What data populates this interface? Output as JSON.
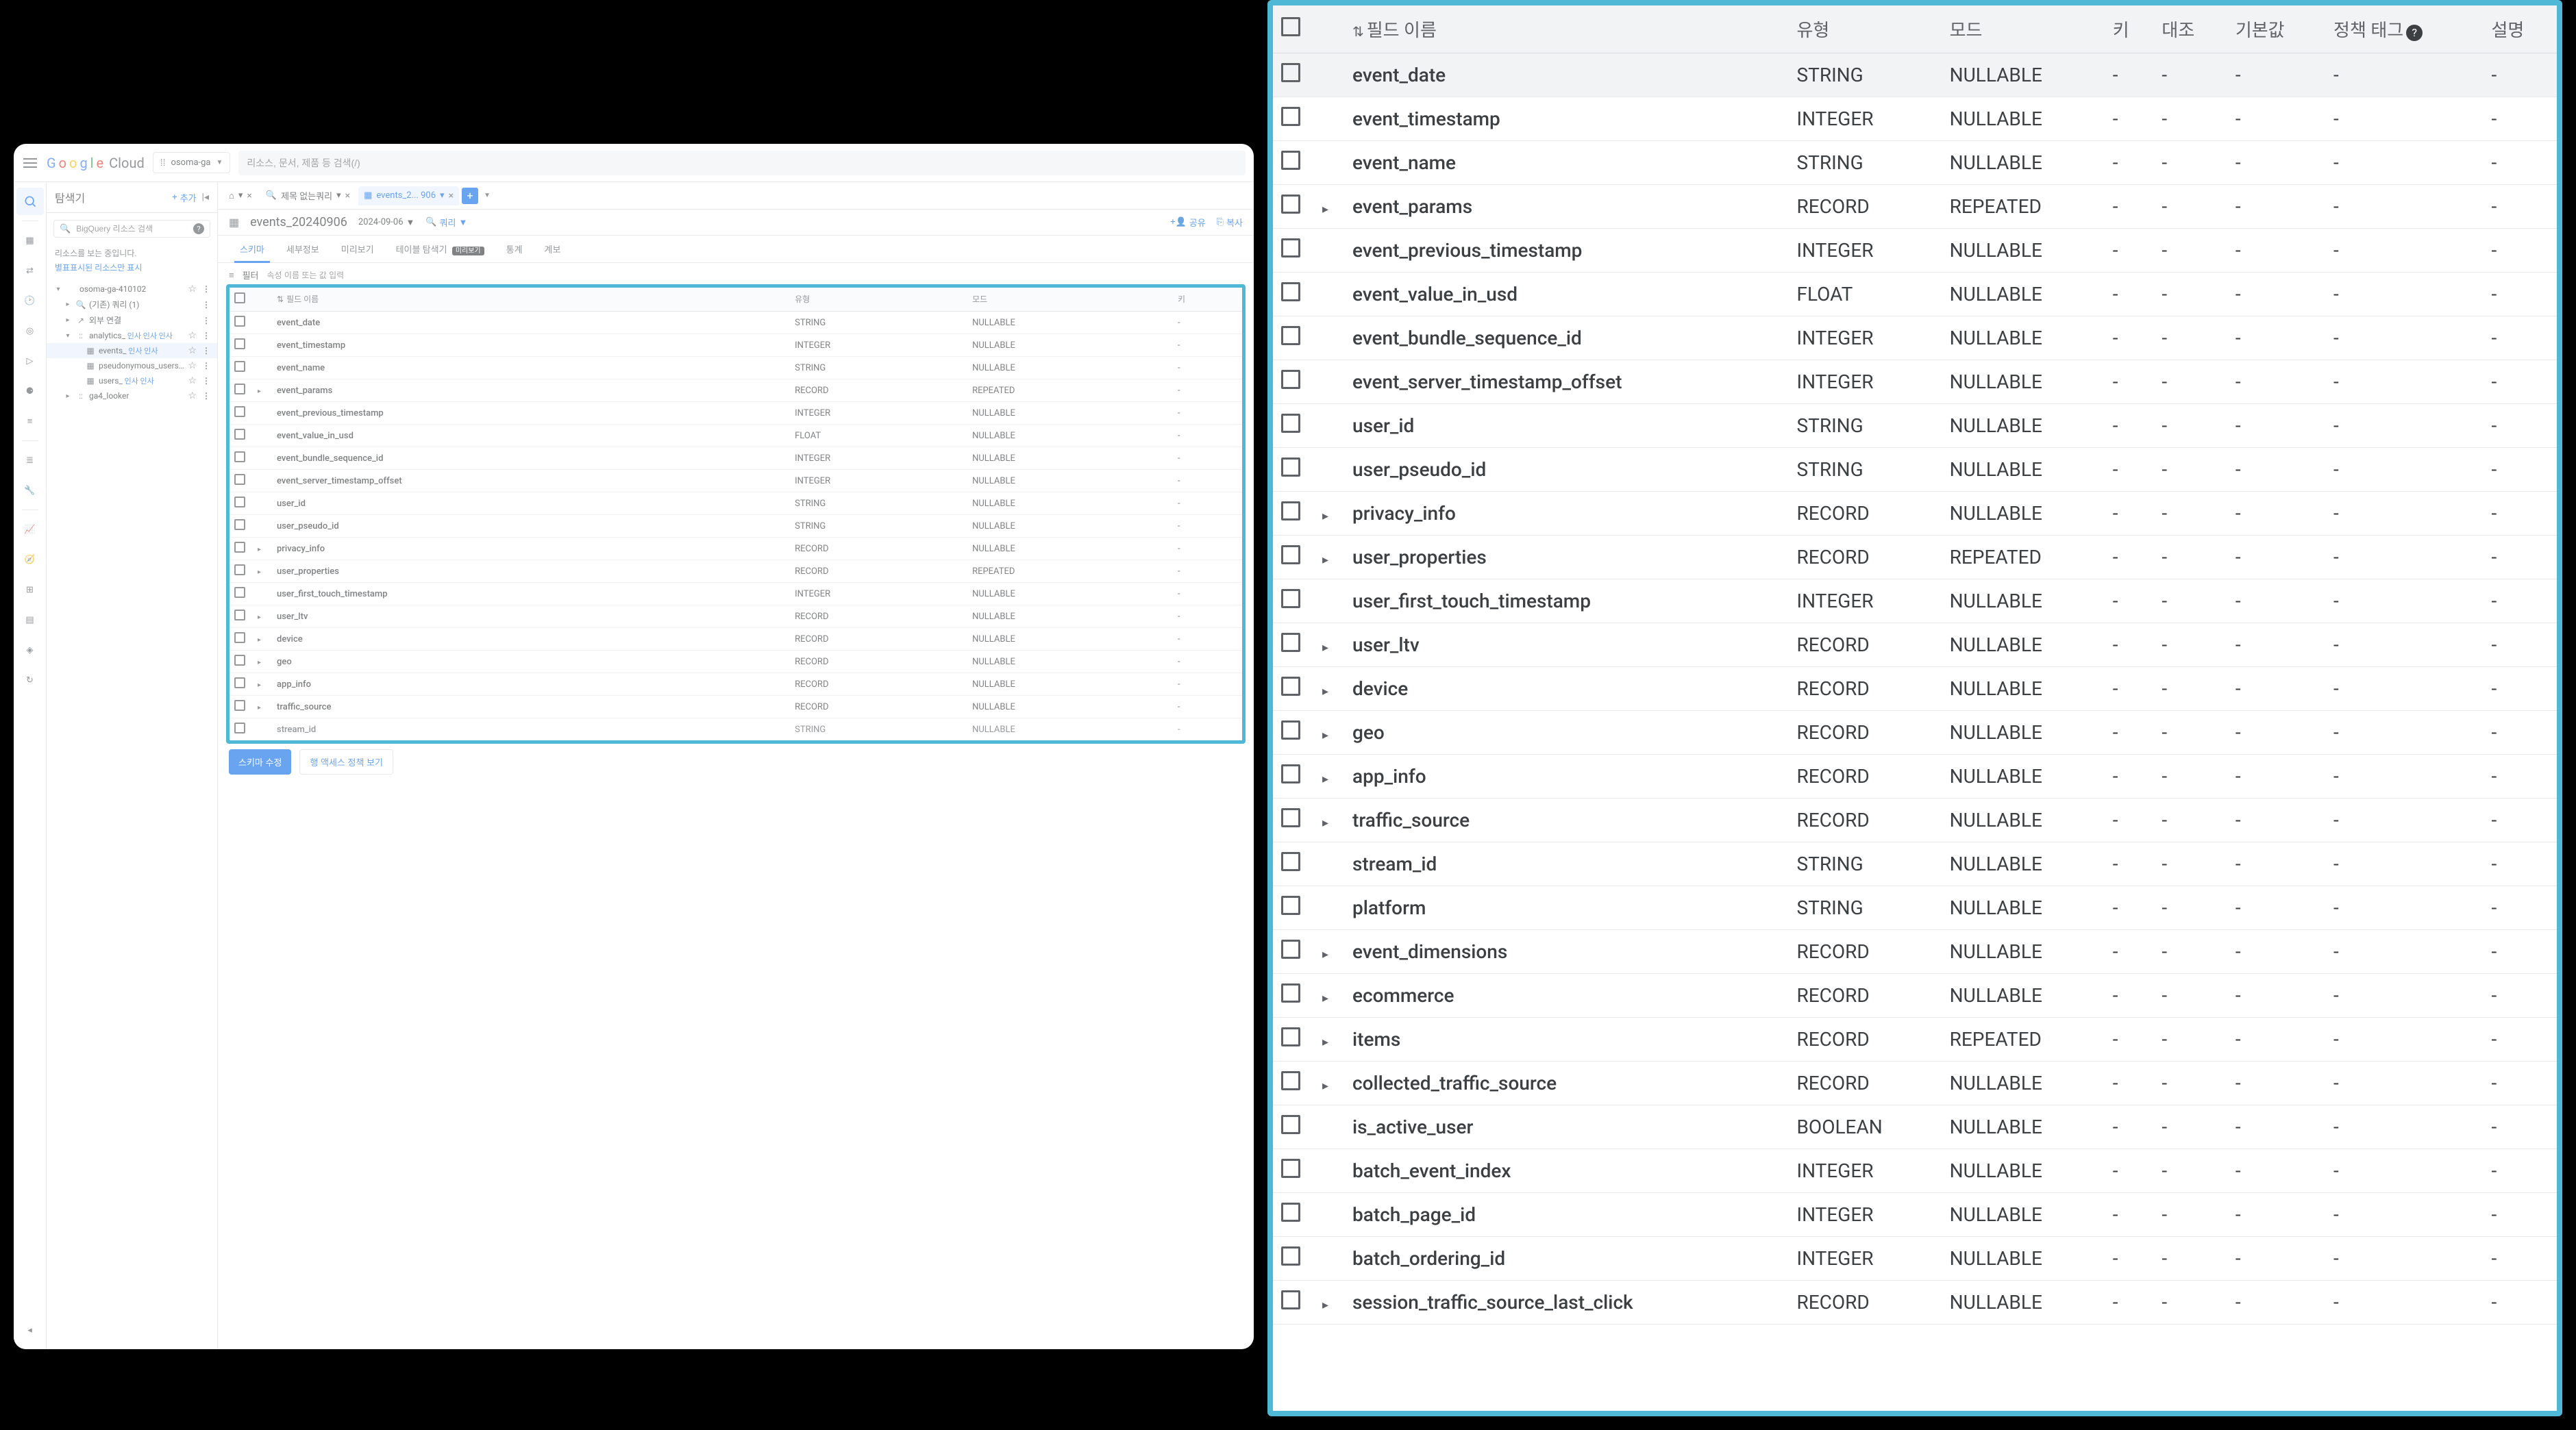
{
  "topbar": {
    "logo_text": "Google",
    "cloud_text": "Cloud",
    "project_name": "osoma-ga",
    "search_placeholder": "리소스, 문서, 제품 등 검색(/)"
  },
  "explorer": {
    "title": "탐색기",
    "add_label": "추가",
    "search_placeholder": "BigQuery 리소스 검색",
    "loading_msg": "리소스를 보는 중입니다.",
    "starred_link": "별표표시된 리소스만 표시",
    "tree": [
      {
        "level": 0,
        "caret": "▾",
        "icon": "",
        "label": "osoma-ga-410102",
        "star": true,
        "menu": true
      },
      {
        "level": 1,
        "caret": "▸",
        "icon": "🔍",
        "label": "(기존) 쿼리 (1)",
        "star": false,
        "menu": true
      },
      {
        "level": 1,
        "caret": "▸",
        "icon": "↗",
        "label": "외부 연결",
        "star": false,
        "menu": true
      },
      {
        "level": 1,
        "caret": "▾",
        "icon": "::",
        "label": "analytics_",
        "anno": "인사 인사 인사",
        "star": true,
        "menu": true
      },
      {
        "level": 2,
        "caret": "",
        "icon": "▦",
        "label": "events_",
        "anno": "인사 인사",
        "star": true,
        "menu": true,
        "selected": true
      },
      {
        "level": 2,
        "caret": "",
        "icon": "▦",
        "label": "pseudonymous_users_ ...",
        "star": true,
        "menu": true
      },
      {
        "level": 2,
        "caret": "",
        "icon": "▦",
        "label": "users_",
        "anno": "인사 인사",
        "star": true,
        "menu": true
      },
      {
        "level": 1,
        "caret": "▸",
        "icon": "::",
        "label": "ga4_looker",
        "star": true,
        "menu": true
      }
    ]
  },
  "tabs": {
    "home_icon": "⌂",
    "untitled_icon": "🔍",
    "untitled_label": "제목 없는쿼리",
    "active_icon": "▦",
    "active_label": "events_2... 906"
  },
  "detail": {
    "table_name": "events_20240906",
    "date_range": "2024-09-06",
    "query_label": "쿼리",
    "share_label": "공유",
    "copy_label": "복사",
    "tabs": {
      "schema": "스키마",
      "details": "세부정보",
      "preview": "미리보기",
      "table_explorer": "테이블 탐색기",
      "preview_chip": "미리보기",
      "stats": "통계",
      "lineage": "계보"
    },
    "filter": {
      "label": "필터",
      "placeholder": "속성 이름 또는 값 입력"
    },
    "actions": {
      "edit_schema": "스키마 수정",
      "row_access_policy": "행 액세스 정책 보기"
    }
  },
  "schema_headers": {
    "field_name": "필드 이름",
    "type": "유형",
    "mode": "모드",
    "key": "키",
    "collation": "대조",
    "default": "기본값",
    "policy_tag": "정책 태그",
    "description": "설명"
  },
  "schema_full": [
    {
      "name": "event_date",
      "type": "STRING",
      "mode": "NULLABLE",
      "expand": false,
      "sel": true
    },
    {
      "name": "event_timestamp",
      "type": "INTEGER",
      "mode": "NULLABLE",
      "expand": false
    },
    {
      "name": "event_name",
      "type": "STRING",
      "mode": "NULLABLE",
      "expand": false
    },
    {
      "name": "event_params",
      "type": "RECORD",
      "mode": "REPEATED",
      "expand": true
    },
    {
      "name": "event_previous_timestamp",
      "type": "INTEGER",
      "mode": "NULLABLE",
      "expand": false
    },
    {
      "name": "event_value_in_usd",
      "type": "FLOAT",
      "mode": "NULLABLE",
      "expand": false
    },
    {
      "name": "event_bundle_sequence_id",
      "type": "INTEGER",
      "mode": "NULLABLE",
      "expand": false
    },
    {
      "name": "event_server_timestamp_offset",
      "type": "INTEGER",
      "mode": "NULLABLE",
      "expand": false
    },
    {
      "name": "user_id",
      "type": "STRING",
      "mode": "NULLABLE",
      "expand": false
    },
    {
      "name": "user_pseudo_id",
      "type": "STRING",
      "mode": "NULLABLE",
      "expand": false
    },
    {
      "name": "privacy_info",
      "type": "RECORD",
      "mode": "NULLABLE",
      "expand": true
    },
    {
      "name": "user_properties",
      "type": "RECORD",
      "mode": "REPEATED",
      "expand": true
    },
    {
      "name": "user_first_touch_timestamp",
      "type": "INTEGER",
      "mode": "NULLABLE",
      "expand": false
    },
    {
      "name": "user_ltv",
      "type": "RECORD",
      "mode": "NULLABLE",
      "expand": true
    },
    {
      "name": "device",
      "type": "RECORD",
      "mode": "NULLABLE",
      "expand": true
    },
    {
      "name": "geo",
      "type": "RECORD",
      "mode": "NULLABLE",
      "expand": true
    },
    {
      "name": "app_info",
      "type": "RECORD",
      "mode": "NULLABLE",
      "expand": true
    },
    {
      "name": "traffic_source",
      "type": "RECORD",
      "mode": "NULLABLE",
      "expand": true
    },
    {
      "name": "stream_id",
      "type": "STRING",
      "mode": "NULLABLE",
      "expand": false
    },
    {
      "name": "platform",
      "type": "STRING",
      "mode": "NULLABLE",
      "expand": false
    },
    {
      "name": "event_dimensions",
      "type": "RECORD",
      "mode": "NULLABLE",
      "expand": true
    },
    {
      "name": "ecommerce",
      "type": "RECORD",
      "mode": "NULLABLE",
      "expand": true
    },
    {
      "name": "items",
      "type": "RECORD",
      "mode": "REPEATED",
      "expand": true
    },
    {
      "name": "collected_traffic_source",
      "type": "RECORD",
      "mode": "NULLABLE",
      "expand": true
    },
    {
      "name": "is_active_user",
      "type": "BOOLEAN",
      "mode": "NULLABLE",
      "expand": false
    },
    {
      "name": "batch_event_index",
      "type": "INTEGER",
      "mode": "NULLABLE",
      "expand": false
    },
    {
      "name": "batch_page_id",
      "type": "INTEGER",
      "mode": "NULLABLE",
      "expand": false
    },
    {
      "name": "batch_ordering_id",
      "type": "INTEGER",
      "mode": "NULLABLE",
      "expand": false
    },
    {
      "name": "session_traffic_source_last_click",
      "type": "RECORD",
      "mode": "NULLABLE",
      "expand": true
    }
  ],
  "schema_left_count": 19
}
